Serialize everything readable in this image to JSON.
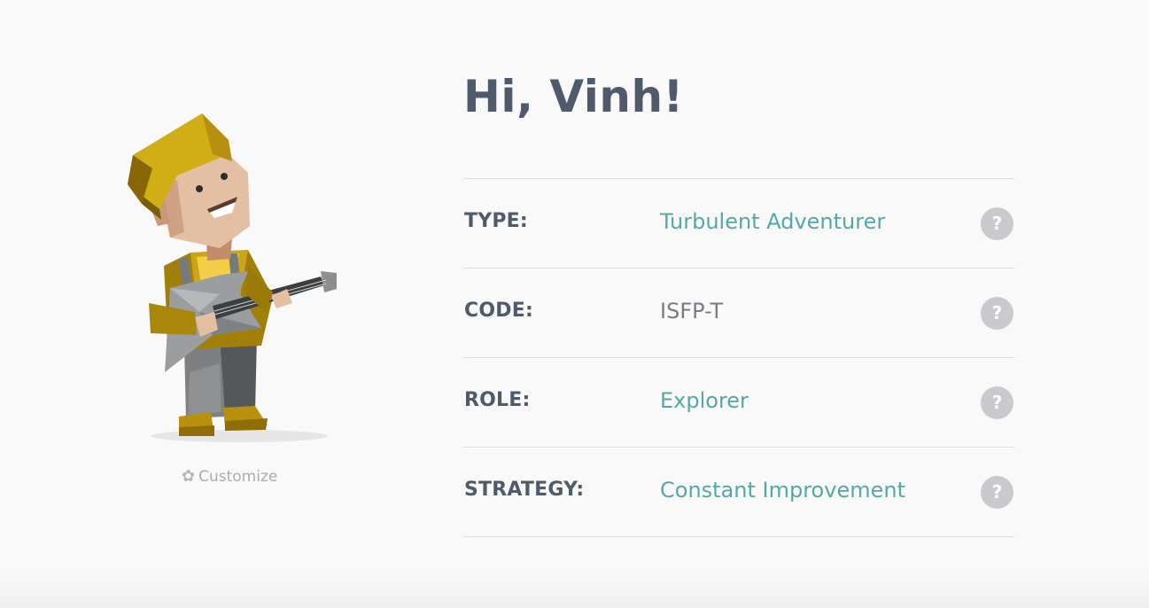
{
  "greeting": "Hi, Vinh!",
  "customize": {
    "label": "Customize",
    "icon": "gear-icon"
  },
  "profile_rows": [
    {
      "label": "TYPE:",
      "value": "Turbulent Adventurer",
      "value_style": "link",
      "help": "?"
    },
    {
      "label": "CODE:",
      "value": "ISFP-T",
      "value_style": "plain",
      "help": "?"
    },
    {
      "label": "ROLE:",
      "value": "Explorer",
      "value_style": "link",
      "help": "?"
    },
    {
      "label": "STRATEGY:",
      "value": "Constant Improvement",
      "value_style": "link",
      "help": "?"
    }
  ],
  "colors": {
    "accent": "#56a8a5",
    "heading": "#4f5a6b",
    "muted": "#777c82",
    "help_badge": "#c8cacd"
  }
}
